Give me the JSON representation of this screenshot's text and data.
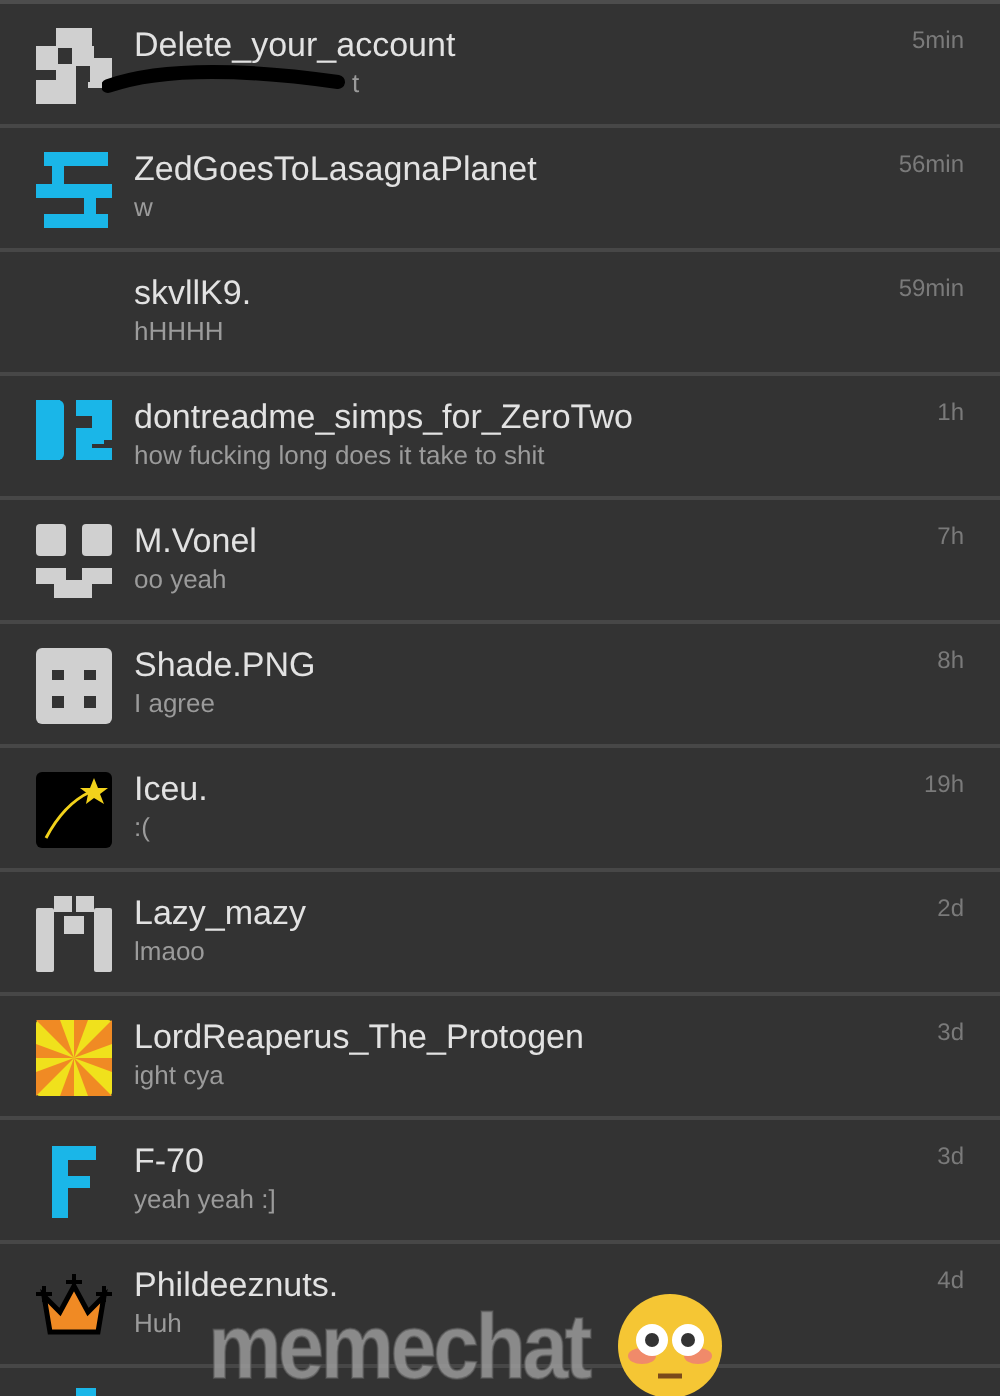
{
  "chats": [
    {
      "kind": "checker",
      "name": "Delete_your_account",
      "preview": "t",
      "preview_scribbled": true,
      "time": "5min"
    },
    {
      "kind": "zed",
      "name": "ZedGoesToLasagnaPlanet",
      "preview": "w",
      "preview_scribbled": false,
      "time": "56min"
    },
    {
      "kind": "no-avatar",
      "name": "skvllK9.",
      "preview": "hHHHH",
      "preview_scribbled": false,
      "time": "59min"
    },
    {
      "kind": "twelve",
      "name": "dontreadme_simps_for_ZeroTwo",
      "preview": "how fucking long does it take to shit",
      "preview_scribbled": false,
      "time": "1h"
    },
    {
      "kind": "vonel",
      "name": "M.Vonel",
      "preview": "oo yeah",
      "preview_scribbled": false,
      "time": "7h"
    },
    {
      "kind": "shade",
      "name": "Shade.PNG",
      "preview": "I agree",
      "preview_scribbled": false,
      "time": "8h"
    },
    {
      "kind": "star",
      "name": "Iceu.",
      "preview": ":(",
      "preview_scribbled": false,
      "time": "19h"
    },
    {
      "kind": "lazy",
      "name": "Lazy_mazy",
      "preview": "lmaoo",
      "preview_scribbled": false,
      "time": "2d"
    },
    {
      "kind": "pinwheel",
      "name": "LordReaperus_The_Protogen",
      "preview": "ight cya",
      "preview_scribbled": false,
      "time": "3d"
    },
    {
      "kind": "f",
      "name": "F-70",
      "preview": "yeah yeah :]",
      "preview_scribbled": false,
      "time": "3d"
    },
    {
      "kind": "crown",
      "name": "Phildeeznuts.",
      "preview": "Huh",
      "preview_scribbled": false,
      "time": "4d"
    },
    {
      "kind": "bar"
    }
  ],
  "caption": {
    "text": "memechat"
  }
}
